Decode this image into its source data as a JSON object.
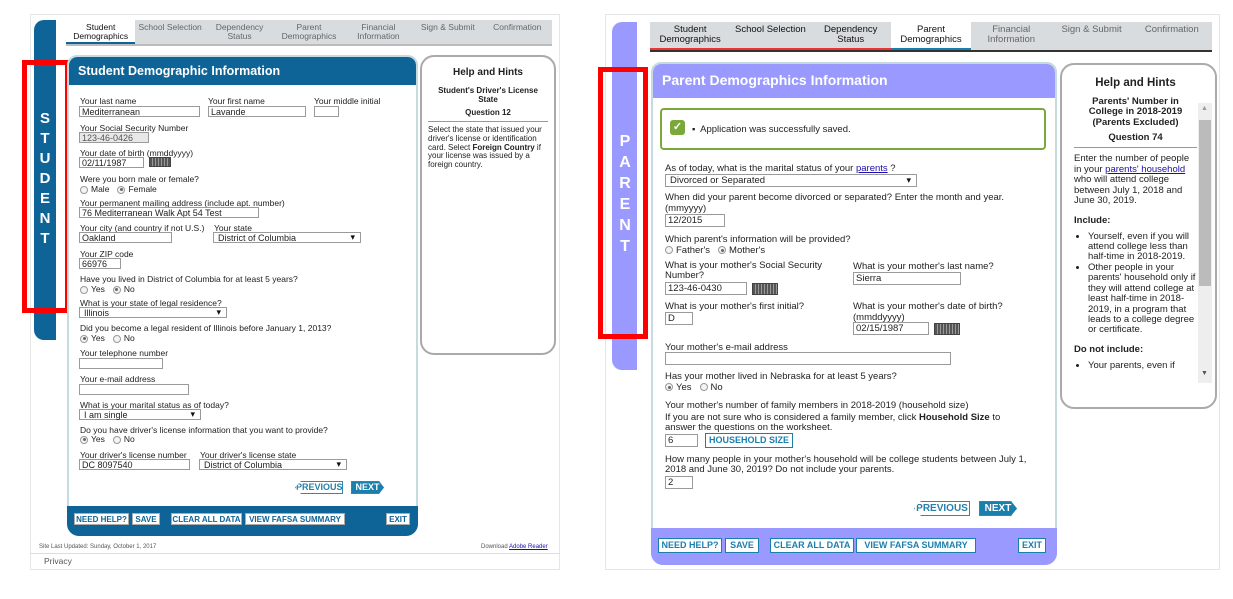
{
  "student": {
    "sidebar_label": "STUDENT",
    "tabs": [
      {
        "label": "Student Demographics"
      },
      {
        "label": "School Selection"
      },
      {
        "label": "Dependency Status"
      },
      {
        "label": "Parent Demographics"
      },
      {
        "label": "Financial Information"
      },
      {
        "label": "Sign & Submit"
      },
      {
        "label": "Confirmation"
      }
    ],
    "title": "Student Demographic Information",
    "fields": {
      "last_name_label": "Your last name",
      "last_name": "Mediterranean",
      "first_name_label": "Your first name",
      "first_name": "Lavande",
      "middle_label": "Your middle initial",
      "middle": "",
      "ssn_label": "Your Social Security Number",
      "ssn": "123-46-0426",
      "dob_label": "Your date of birth (mmddyyyy)",
      "dob": "02/11/1987",
      "sex_label": "Were you born male or female?",
      "sex_male": "Male",
      "sex_female": "Female",
      "address_label": "Your permanent mailing address (include apt. number)",
      "address": "76 Mediterranean Walk Apt 54 Test",
      "city_label": "Your city (and country if not U.S.)",
      "city": "Oakland",
      "state_label": "Your state",
      "state": "District of Columbia",
      "zip_label": "Your ZIP code",
      "zip": "66976",
      "lived5_label": "Have you lived in District of Columbia for at least 5 years?",
      "yes": "Yes",
      "no": "No",
      "legal_label": "What is your state of legal residence?",
      "legal": "Illinois",
      "before_label": "Did you become a legal resident of Illinois before January 1, 2013?",
      "phone_label": "Your telephone number",
      "phone": "",
      "email_label": "Your e-mail address",
      "email": "",
      "marital_label": "What is your marital status as of today?",
      "marital": "I am single",
      "dl_q_label": "Do you have driver's license information that you want to provide?",
      "dl_num_label": "Your driver's license number",
      "dl_num": "DC 8097540",
      "dl_state_label": "Your driver's license state",
      "dl_state": "District of Columbia"
    },
    "previous": "PREVIOUS",
    "next": "NEXT",
    "bottom": {
      "help": "NEED HELP?",
      "save": "SAVE",
      "clear": "CLEAR ALL DATA",
      "summary": "VIEW FAFSA SUMMARY",
      "exit": "EXIT"
    },
    "help": {
      "title": "Help and Hints",
      "heading": "Student's Driver's License State",
      "question": "Question 12",
      "text1": "Select the state that issued your driver's license or identification card. Select ",
      "bold": "Foreign Country",
      "text2": " if your license was issued by a foreign country."
    },
    "footer": {
      "updated": "Site Last Updated: Sunday, October 1, 2017",
      "download": "Download",
      "adobe": "Adobe Reader",
      "privacy": "Privacy"
    },
    "color": "#0f6497"
  },
  "parent": {
    "sidebar_label": "PARENT",
    "tabs": [
      {
        "label": "Student Demographics"
      },
      {
        "label": "School Selection"
      },
      {
        "label": "Dependency Status"
      },
      {
        "label": "Parent Demographics"
      },
      {
        "label": "Financial Information"
      },
      {
        "label": "Sign & Submit"
      },
      {
        "label": "Confirmation"
      }
    ],
    "title": "Parent Demographics Information",
    "saved": "Application was successfully saved.",
    "fields": {
      "marital_label": "As of today, what is the marital status of your",
      "marital_link": "parents",
      "marital_q": " ?",
      "marital": "Divorced or Separated",
      "when_label": "When did your parent become divorced or separated? Enter the month and year.",
      "when_fmt": "(mmyyyy)",
      "when": "12/2015",
      "which_label": "Which parent's information will be provided?",
      "father": "Father's",
      "mother": "Mother's",
      "ssn_label": "What is your mother's Social Security Number?",
      "ssn": "123-46-0430",
      "last_label": "What is your mother's last name?",
      "last": "Sierra",
      "initial_label": "What is your mother's first initial?",
      "initial": "D",
      "dob_label": "What is your mother's date of birth?",
      "dob_fmt": "(mmddyyyy)",
      "dob": "02/15/1987",
      "email_label": "Your mother's e-mail address",
      "email": "",
      "lived_label": "Has your mother lived in Nebraska for at least 5 years?",
      "yes": "Yes",
      "no": "No",
      "hh_label": "Your mother's number of family members in 2018-2019 (household size)",
      "hh_help1": "If you are not sure who is considered a family member, click ",
      "hh_help_bold": "Household Size",
      "hh_help2": " to answer the questions on the worksheet.",
      "hh": "6",
      "hh_button": "HOUSEHOLD SIZE",
      "college_label": "How many people in your mother's household will be college students between July 1, 2018 and June 30, 2019? Do not include your parents.",
      "college": "2"
    },
    "previous": "PREVIOUS",
    "next": "NEXT",
    "bottom": {
      "help": "NEED HELP?",
      "save": "SAVE",
      "clear": "CLEAR ALL DATA",
      "summary": "VIEW FAFSA SUMMARY",
      "exit": "EXIT"
    },
    "help": {
      "title": "Help and Hints",
      "heading": "Parents' Number in College in 2018-2019 (Parents Excluded)",
      "question": "Question 74",
      "t1": "Enter the number of people in your ",
      "link": "parents' household",
      "t2": " who will attend college between July 1, 2018 and June 30, 2019.",
      "include": "Include:",
      "inc1": "Yourself, even if you will attend college less than half-time in 2018-2019.",
      "inc2": "Other people in your parents' household only if they will attend college at least half-time in 2018-2019, in a program that leads to a college degree or certificate.",
      "exclude": "Do not include:",
      "exc1": "Your parents, even if"
    },
    "color": "#9999ff"
  }
}
